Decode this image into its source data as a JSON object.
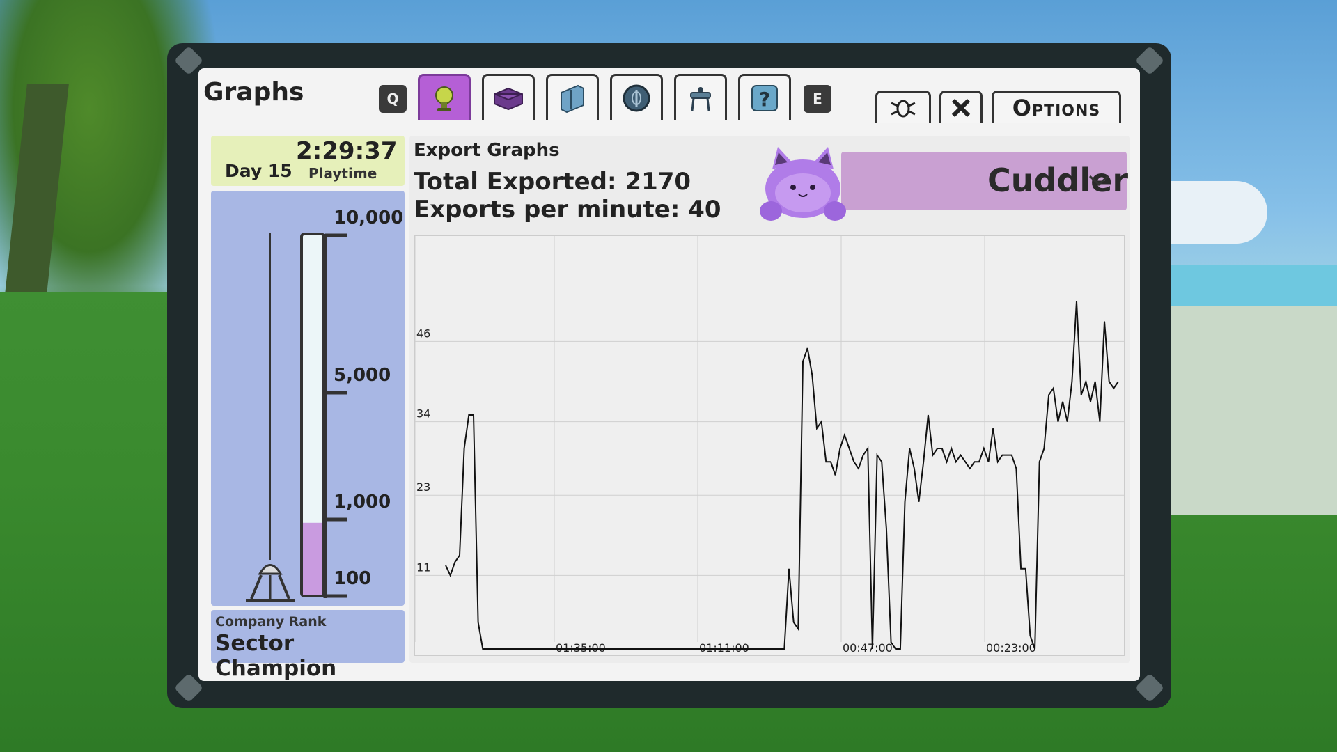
{
  "window": {
    "title": "Graphs"
  },
  "tabs": {
    "prev_key": "Q",
    "next_key": "E",
    "items": [
      {
        "icon": "trophy-icon",
        "active": true
      },
      {
        "icon": "crate-icon",
        "active": false
      },
      {
        "icon": "panel-icon",
        "active": false
      },
      {
        "icon": "coin-icon",
        "active": false
      },
      {
        "icon": "lab-icon",
        "active": false
      },
      {
        "icon": "question-icon",
        "active": false
      }
    ]
  },
  "topbar": {
    "options_label": "Options"
  },
  "playtime": {
    "time": "2:29:37",
    "day": "Day 15",
    "label": "Playtime"
  },
  "gauge": {
    "labels": [
      "10,000",
      "5,000",
      "1,000",
      "100"
    ],
    "fill_fraction": 0.2
  },
  "rank": {
    "caption": "Company Rank",
    "value": "Sector Champion"
  },
  "export": {
    "title": "Export Graphs",
    "total": "Total Exported: 2170",
    "rate": "Exports per minute: 40",
    "selected_item": "Cuddler"
  },
  "chart_data": {
    "type": "line",
    "title": "",
    "xlabel": "",
    "ylabel": "",
    "y_ticks": [
      "46",
      "34",
      "23",
      "11"
    ],
    "x_ticks": [
      "01:35:00",
      "01:11:00",
      "00:47:00",
      "00:23:00"
    ],
    "ylim": [
      0,
      55
    ],
    "grid": true,
    "series": [
      {
        "values": [
          12.5,
          11,
          13,
          14,
          30,
          35,
          35,
          4,
          0,
          0,
          0,
          0,
          0,
          0,
          0,
          0,
          0,
          0,
          0,
          0,
          0,
          0,
          0,
          0,
          0,
          0,
          0,
          0,
          0,
          0,
          0,
          0,
          0,
          0,
          0,
          0,
          0,
          0,
          0,
          0,
          0,
          0,
          0,
          0,
          0,
          0,
          0,
          0,
          0,
          0,
          0,
          0,
          0,
          0,
          0,
          0,
          0,
          0,
          0,
          0,
          0,
          0,
          0,
          0,
          0,
          0,
          0,
          0,
          0,
          0,
          0,
          0,
          0,
          0,
          12,
          4,
          3,
          43,
          45,
          41,
          33,
          34,
          28,
          28,
          26,
          30,
          32,
          30,
          28,
          27,
          29,
          30,
          0,
          29,
          28,
          18,
          1,
          0,
          0,
          22,
          30,
          27,
          22,
          28,
          35,
          29,
          30,
          30,
          28,
          30,
          28,
          29,
          28,
          27,
          28,
          28,
          30,
          28,
          33,
          28,
          29,
          29,
          29,
          27,
          12,
          12,
          2,
          0,
          28,
          30,
          38,
          39,
          34,
          37,
          34,
          40,
          52,
          38,
          40,
          37,
          40,
          34,
          49,
          40,
          39,
          40
        ]
      }
    ]
  },
  "colors": {
    "accent": "#b55fd6",
    "gauge_fill": "#c99be0",
    "panel_frame": "#1f2a2c"
  }
}
